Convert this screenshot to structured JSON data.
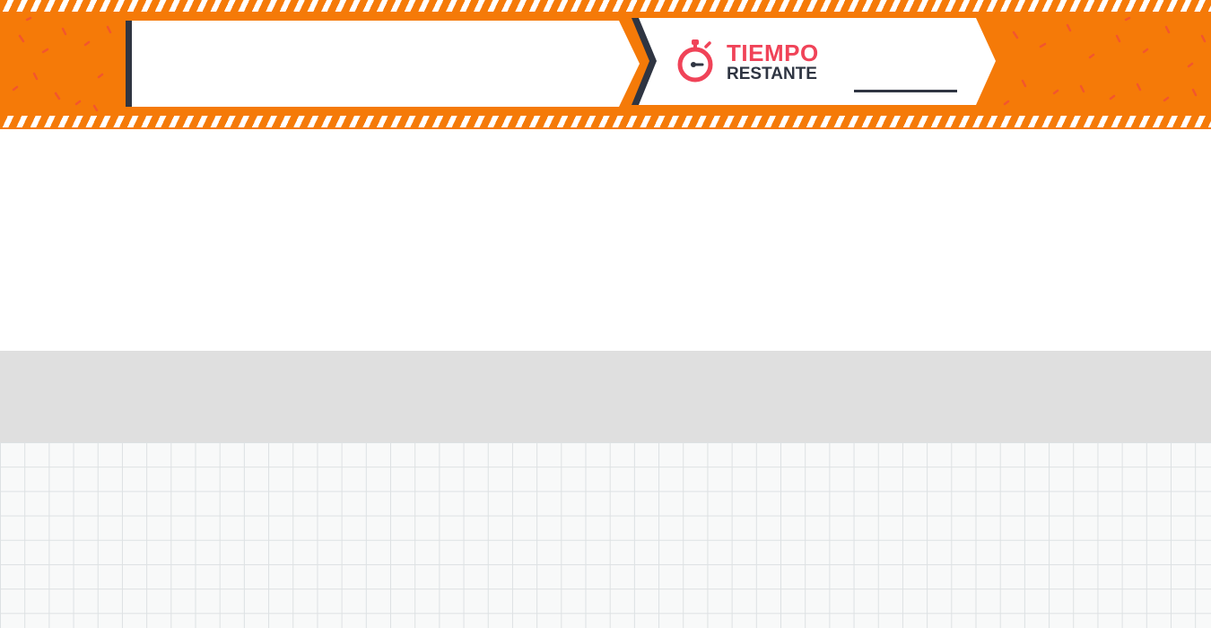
{
  "timer": {
    "label_line1": "TIEMPO",
    "label_line2": "RESTANTE",
    "value": "",
    "icon": "stopwatch-icon"
  },
  "title": {
    "text": ""
  },
  "colors": {
    "banner_orange": "#f57a08",
    "timer_red": "#f04358",
    "dark_slate": "#2f3542",
    "gray_bar": "#dfdfdf",
    "grid_line": "#dde1e3"
  }
}
